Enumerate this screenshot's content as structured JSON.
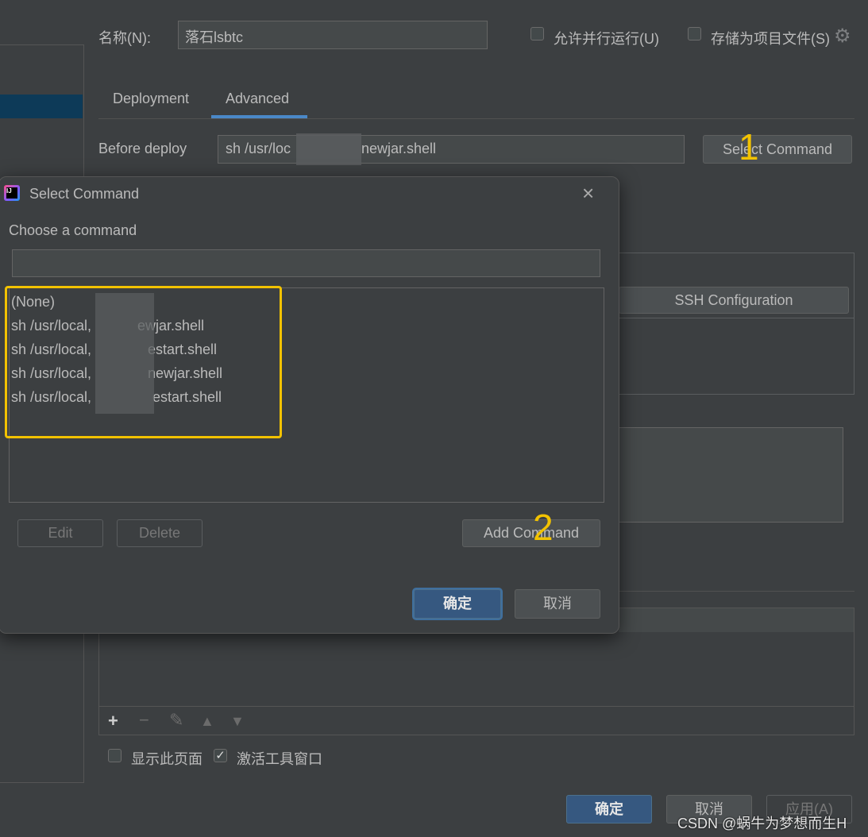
{
  "config": {
    "name_label": "名称(N):",
    "name_value": "落石lsbtc",
    "allow_parallel_label": "允许并行运行(U)",
    "store_as_file_label": "存储为项目文件(S)",
    "tabs": [
      {
        "label": "Deployment"
      },
      {
        "label": "Advanced"
      }
    ],
    "active_tab": "Advanced",
    "before_deploy_label": "Before deploy",
    "before_deploy_value_start": "sh /usr/loc",
    "before_deploy_value_end": "newjar.shell",
    "select_command_label": "Select Command",
    "ssh_config_label": "SSH Configuration",
    "show_page_label": "显示此页面",
    "activate_tool_window_label": "激活工具窗口",
    "ok_label": "确定",
    "cancel_label": "取消",
    "apply_label": "应用(A)"
  },
  "dialog": {
    "title": "Select Command",
    "app_icon_text": "IJ",
    "prompt": "Choose a command",
    "filter_value": "",
    "items": [
      {
        "start": "(None)",
        "end": ""
      },
      {
        "start": "sh /usr/local,",
        "end": "ewjar.shell"
      },
      {
        "start": "sh /usr/local,",
        "end": "estart.shell"
      },
      {
        "start": "sh /usr/local,",
        "end": "newjar.shell"
      },
      {
        "start": "sh /usr/local,",
        "end": "estart.shell"
      }
    ],
    "edit_label": "Edit",
    "delete_label": "Delete",
    "add_command_label": "Add Command",
    "ok_label": "确定",
    "cancel_label": "取消"
  },
  "annotations": {
    "marker_1": "1",
    "marker_2": "2",
    "highlight_color": "#f2c200"
  },
  "watermark": "CSDN @蜗牛为梦想而生H",
  "colors": {
    "background": "#3c3f41",
    "accent_tab": "#4a88c7",
    "primary_button": "#365880",
    "selection": "#0d3a58"
  }
}
